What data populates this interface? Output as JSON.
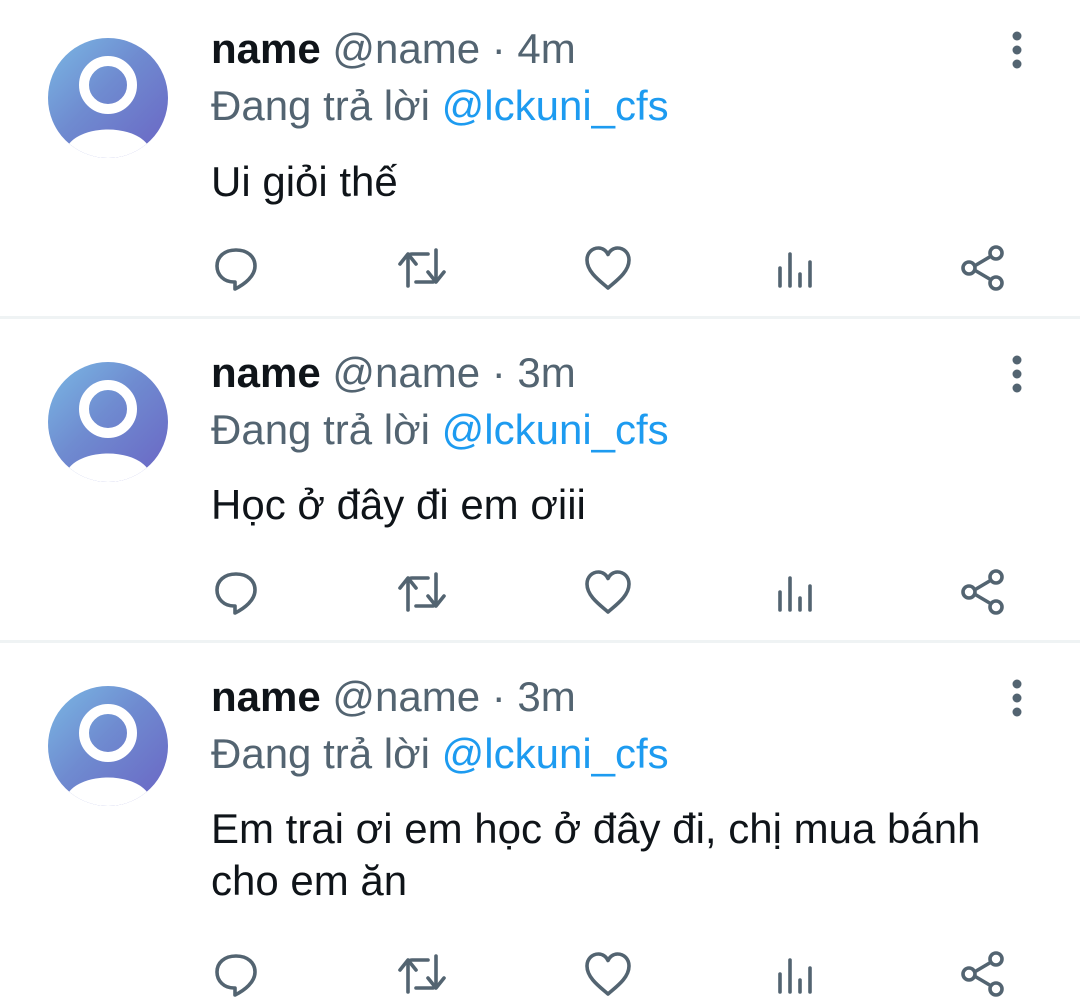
{
  "tweets": [
    {
      "name": "name",
      "handle": "@name",
      "separator": " · ",
      "time": "4m",
      "reply_prefix": "Đang trả lời ",
      "reply_to": "@lckuni_cfs",
      "text": "Ui giỏi thế"
    },
    {
      "name": "name",
      "handle": "@name",
      "separator": " · ",
      "time": "3m",
      "reply_prefix": "Đang trả lời ",
      "reply_to": "@lckuni_cfs",
      "text": "Học ở đây đi em ơiii"
    },
    {
      "name": "name",
      "handle": "@name",
      "separator": " · ",
      "time": "3m",
      "reply_prefix": "Đang trả lời ",
      "reply_to": "@lckuni_cfs",
      "text": "Em trai ơi em học ở đây đi, chị mua bánh cho em ăn"
    }
  ],
  "icons": {
    "avatar": "default-avatar-icon",
    "more": "more-vertical-icon",
    "reply": "reply-bubble-icon",
    "retweet": "retweet-icon",
    "like": "heart-icon",
    "views": "bar-chart-icon",
    "share": "share-icon"
  },
  "colors": {
    "text": "#0f1419",
    "secondary": "#536471",
    "mention": "#1d9bf0",
    "divider": "#eff3f4",
    "avatar_gradient_start": "#7ab8e4",
    "avatar_gradient_end": "#6a64c4"
  }
}
